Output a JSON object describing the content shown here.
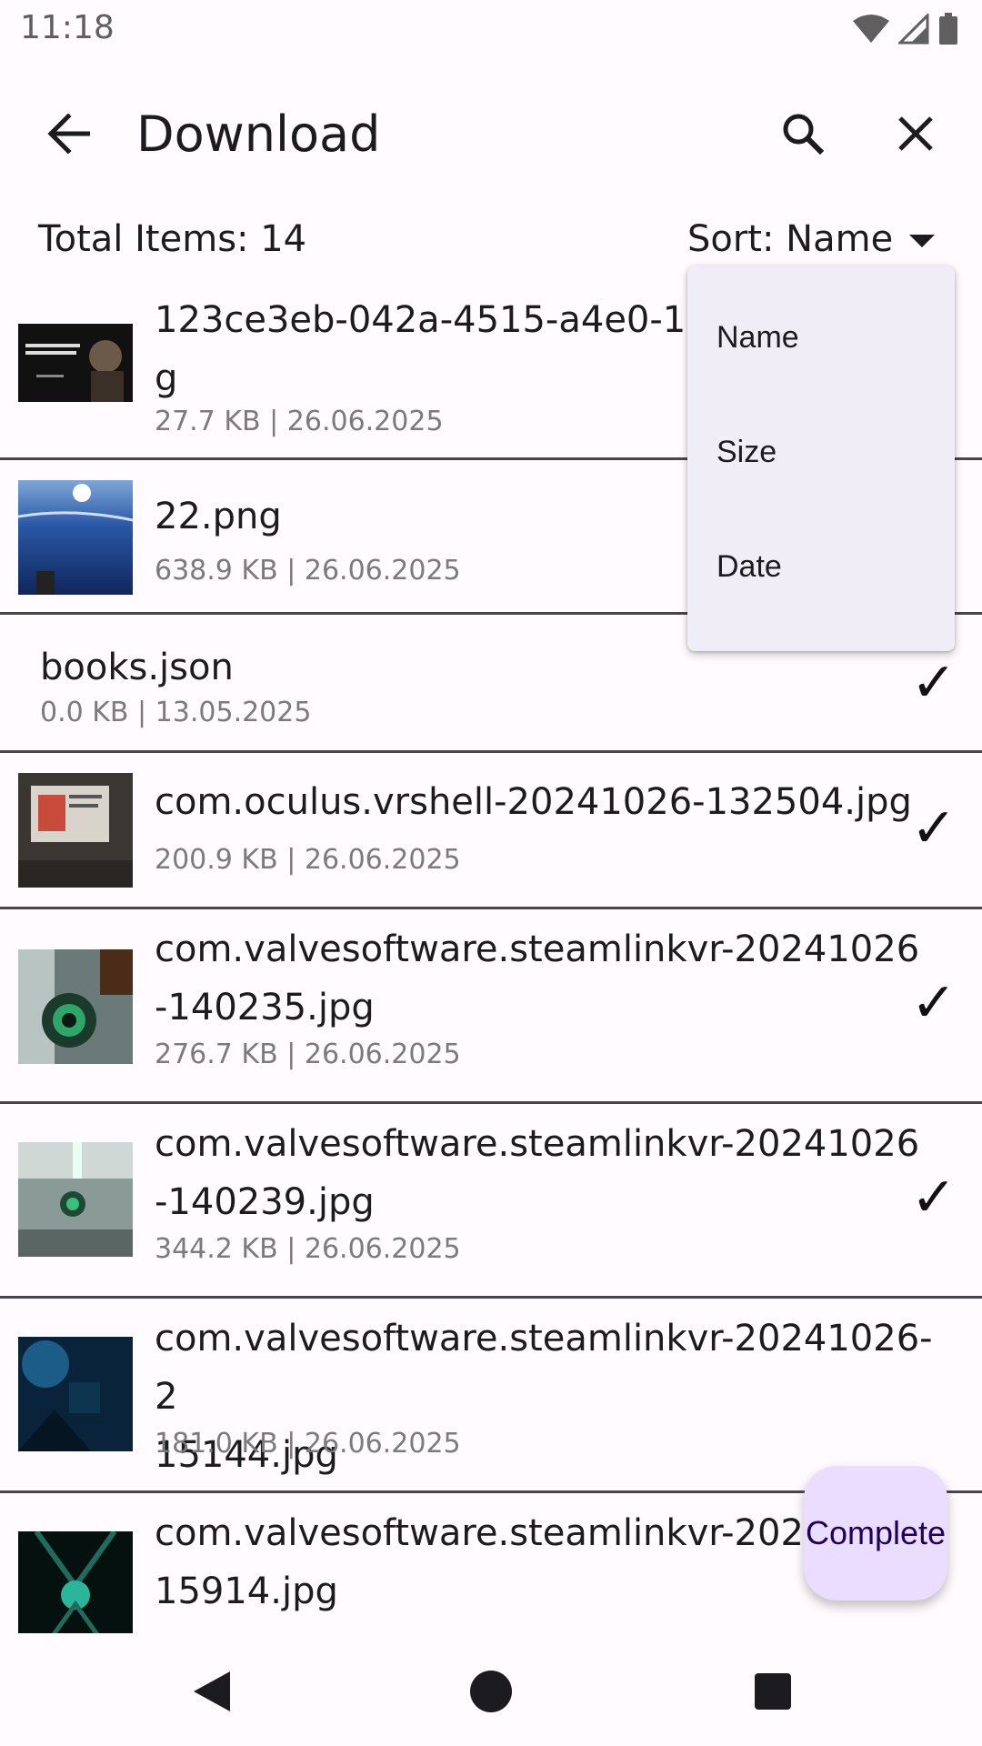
{
  "status": {
    "time": "11:18"
  },
  "app_bar": {
    "title": "Download"
  },
  "header": {
    "total_label": "Total Items: 14",
    "sort_label": "Sort: Name"
  },
  "sort_menu": {
    "options": [
      "Name",
      "Size",
      "Date"
    ]
  },
  "files": [
    {
      "name_line1": "123ce3eb-042a-4515-a4e0-1c",
      "name_line2": "g",
      "meta": "27.7 KB  |  26.06.2025",
      "checked": false,
      "thumb": "newton-quote"
    },
    {
      "name_line1": "22.png",
      "name_line2": "",
      "meta": "638.9 KB  |  26.06.2025",
      "checked": false,
      "thumb": "ocean"
    },
    {
      "name_line1": "books.json",
      "name_line2": "",
      "meta": "0.0 KB  |  13.05.2025",
      "checked": true,
      "thumb": ""
    },
    {
      "name_line1": "com.oculus.vrshell-20241026-132504.jpg",
      "name_line2": "",
      "meta": "200.9 KB  |  26.06.2025",
      "checked": true,
      "thumb": "room"
    },
    {
      "name_line1": "com.valvesoftware.steamlinkvr-20241026",
      "name_line2": "-140235.jpg",
      "meta": "276.7 KB  |  26.06.2025",
      "checked": true,
      "thumb": "game-green"
    },
    {
      "name_line1": "com.valvesoftware.steamlinkvr-20241026",
      "name_line2": "-140239.jpg",
      "meta": "344.2 KB  |  26.06.2025",
      "checked": true,
      "thumb": "game-light"
    },
    {
      "name_line1": "com.valvesoftware.steamlinkvr-20241026-2",
      "name_line2": "15144.jpg",
      "meta": "181.0 KB  |  26.06.2025",
      "checked": false,
      "thumb": "game-blue"
    },
    {
      "name_line1": "com.valvesoftware.steamlinkvr-2024",
      "name_line2": "15914.jpg",
      "meta": "",
      "checked": false,
      "thumb": "game-teal"
    }
  ],
  "fab": {
    "label": "Complete"
  },
  "colors": {
    "accent": "#eaddff",
    "fab_text": "#21005d",
    "menu_bg": "#f1edf6",
    "divider": "#49454f"
  }
}
